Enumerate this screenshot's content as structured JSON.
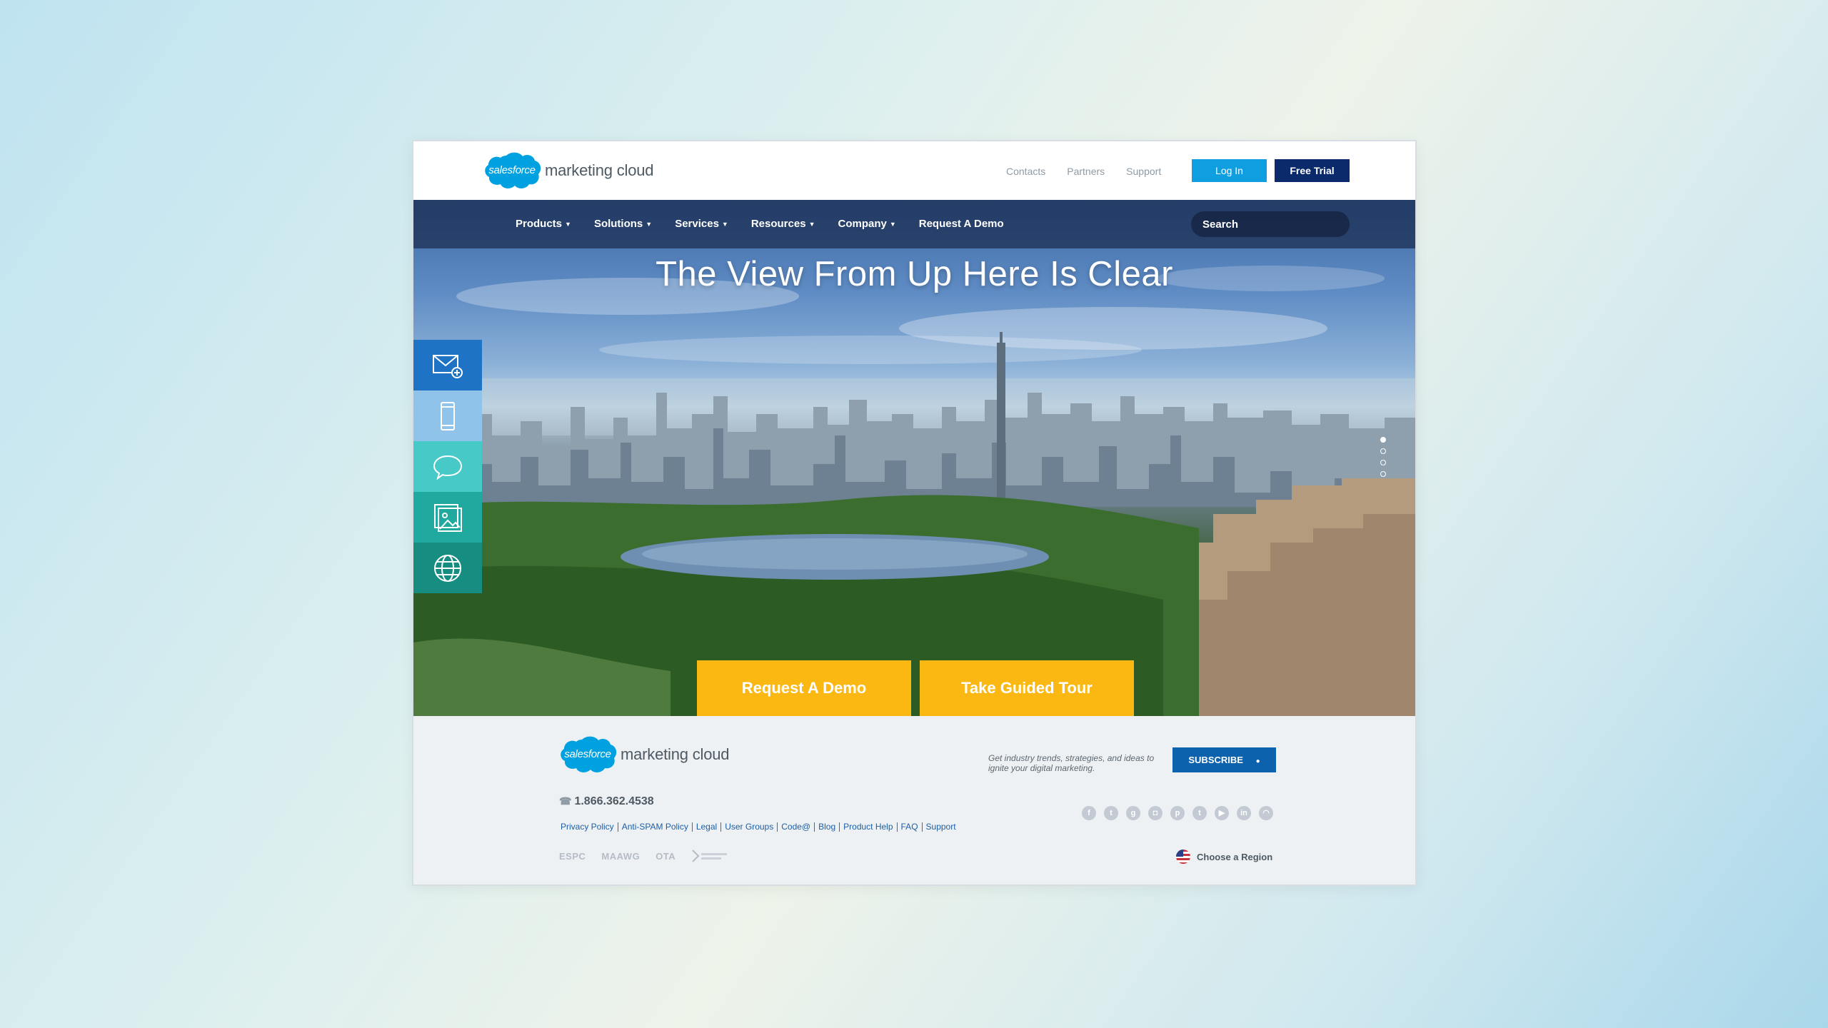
{
  "brand": {
    "logo_wordmark": "salesforce",
    "product_name": "marketing cloud"
  },
  "header": {
    "links": [
      "Contacts",
      "Partners",
      "Support"
    ],
    "login_label": "Log In",
    "trial_label": "Free Trial"
  },
  "nav": {
    "items": [
      {
        "label": "Products",
        "has_dropdown": true
      },
      {
        "label": "Solutions",
        "has_dropdown": true
      },
      {
        "label": "Services",
        "has_dropdown": true
      },
      {
        "label": "Resources",
        "has_dropdown": true
      },
      {
        "label": "Company",
        "has_dropdown": true
      },
      {
        "label": "Request A Demo",
        "has_dropdown": false
      }
    ],
    "search_placeholder": "Search"
  },
  "hero": {
    "title": "The View From Up Here Is Clear",
    "side_tabs": [
      {
        "icon": "mail-plus-icon",
        "color": "#1f73c4"
      },
      {
        "icon": "mobile-phone-icon",
        "color": "#8fc3ea"
      },
      {
        "icon": "chat-bubble-icon",
        "color": "#47c9c8"
      },
      {
        "icon": "image-gallery-icon",
        "color": "#20a99e"
      },
      {
        "icon": "globe-icon",
        "color": "#168d80"
      }
    ],
    "carousel": {
      "count": 4,
      "active_index": 0
    },
    "cta_demo": "Request A Demo",
    "cta_tour": "Take Guided Tour"
  },
  "footer": {
    "tagline": "Get industry trends, strategies, and ideas to ignite your digital marketing.",
    "subscribe_label": "SUBSCRIBE",
    "phone": "1.866.362.4538",
    "links": [
      "Privacy Policy",
      "Anti-SPAM Policy",
      "Legal",
      "User Groups",
      "Code@",
      "Blog",
      "Product Help",
      "FAQ",
      "Support"
    ],
    "socials": [
      "facebook-icon",
      "twitter-icon",
      "google-plus-icon",
      "instagram-icon",
      "pinterest-icon",
      "tumblr-icon",
      "youtube-icon",
      "linkedin-icon",
      "rss-icon"
    ],
    "associations": [
      "ESPC",
      "MAAWG",
      "OTA"
    ],
    "region_label": "Choose a Region"
  },
  "colors": {
    "brand_blue": "#00a1e0",
    "login_blue": "#0f9ee0",
    "trial_navy": "#0b2a6c",
    "cta_yellow": "#fcb812",
    "subscribe_blue": "#0d62ae"
  }
}
